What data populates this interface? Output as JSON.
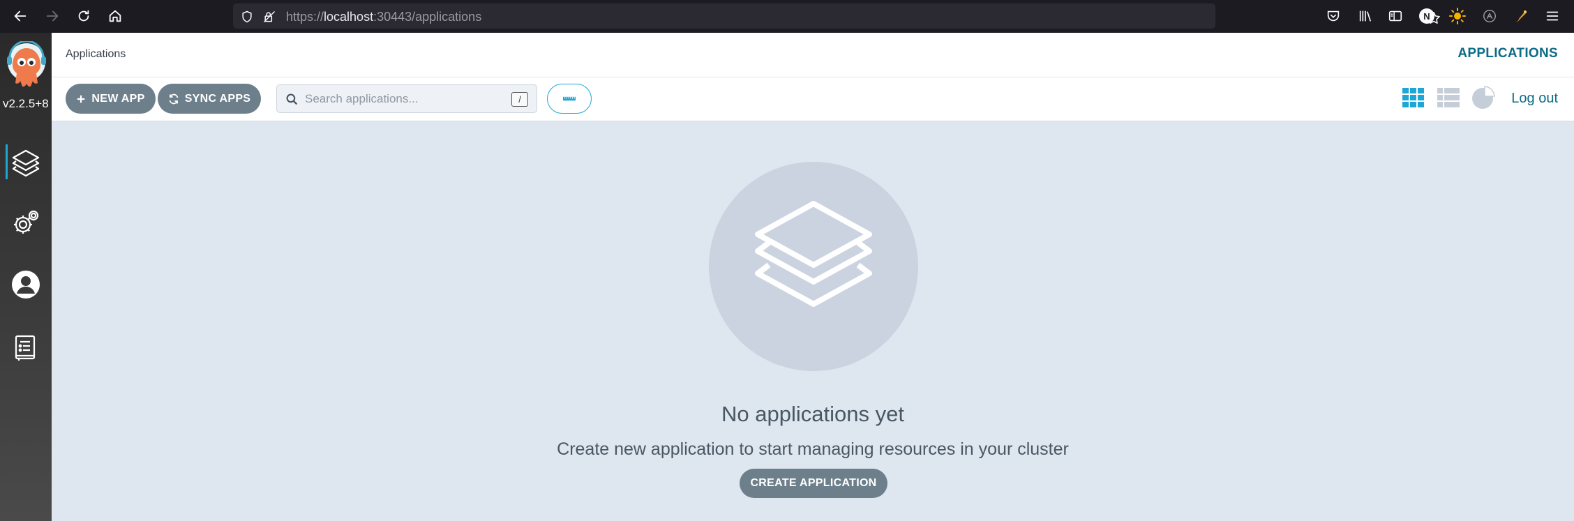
{
  "browser": {
    "url_prefix": "https://",
    "url_host": "localhost",
    "url_rest": ":30443/applications",
    "profile_initial": "N"
  },
  "sidebar": {
    "version": "v2.2.5+8",
    "items": [
      {
        "icon": "layers-icon",
        "active": true
      },
      {
        "icon": "gear-icon",
        "active": false
      },
      {
        "icon": "user-icon",
        "active": false
      },
      {
        "icon": "docs-icon",
        "active": false
      }
    ]
  },
  "header": {
    "title": "Applications",
    "right_label": "APPLICATIONS"
  },
  "toolbar": {
    "new_app_label": "NEW APP",
    "sync_apps_label": "SYNC APPS",
    "search_placeholder": "Search applications...",
    "search_shortcut": "/",
    "logout_label": "Log out"
  },
  "empty_state": {
    "title": "No applications yet",
    "subtitle": "Create new application to start managing resources in your cluster",
    "button_label": "CREATE APPLICATION"
  },
  "colors": {
    "accent": "#1ea7d6",
    "link": "#0c6b86",
    "button": "#6d7f8b",
    "background": "#dee6f0"
  }
}
